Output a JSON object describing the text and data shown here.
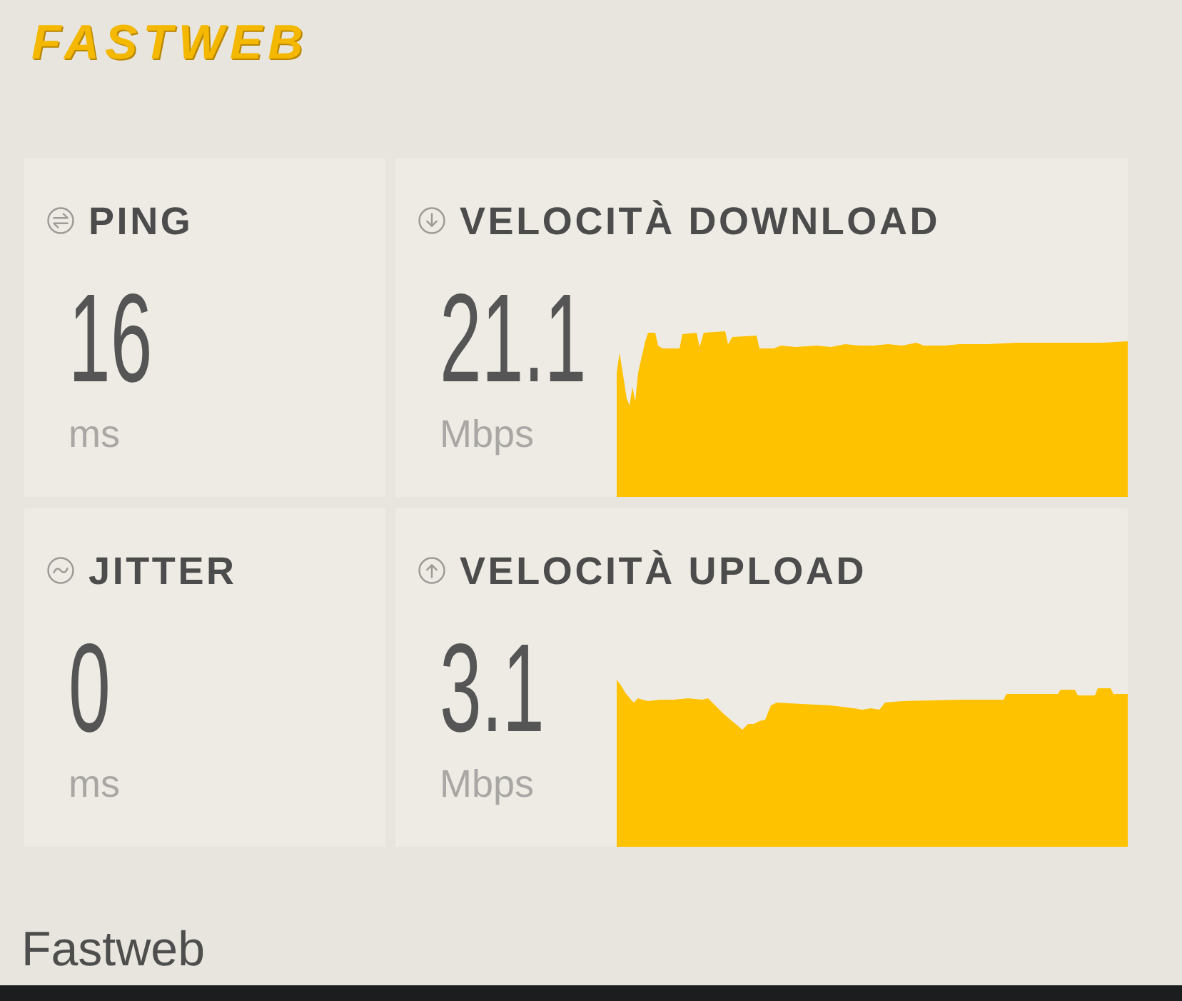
{
  "logo": {
    "text": "FASTWEB"
  },
  "cards": [
    {
      "kind": "ping",
      "title": "PING",
      "value": "16",
      "unit": "ms"
    },
    {
      "kind": "download",
      "title": "VELOCITÀ DOWNLOAD",
      "value": "21.1",
      "unit": "Mbps"
    },
    {
      "kind": "jitter",
      "title": "JITTER",
      "value": "0",
      "unit": "ms"
    },
    {
      "kind": "upload",
      "title": "VELOCITÀ UPLOAD",
      "value": "3.1",
      "unit": "Mbps"
    }
  ],
  "footer": {
    "provider": "Fastweb"
  }
}
